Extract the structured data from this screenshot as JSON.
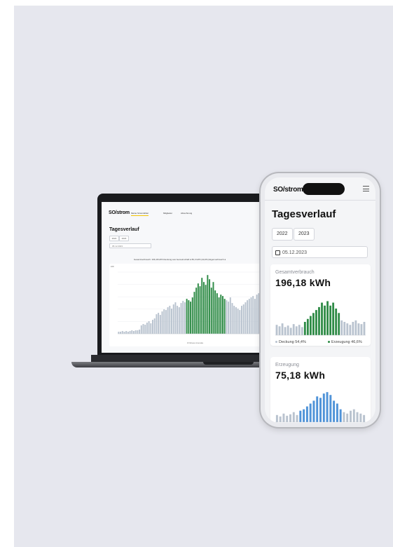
{
  "brand": "SO/strom",
  "desktop": {
    "nav": [
      "Meine Stromzähler",
      "Mitglieder",
      "Abrechnung"
    ],
    "title": "Tagesverlauf",
    "years": [
      "2022",
      "2023"
    ],
    "date": "05.12.2023",
    "stats": "Gesamtverbrauch: 196,18 kWh   Deckung aus Gemeinschaft ● 86,3 kWh (44,0%)   Eigenverbrauch ●",
    "y_axis_unit": "kWh",
    "x_axis_label": "15 Minuten Intervalle"
  },
  "mobile": {
    "title": "Tagesverlauf",
    "years": [
      "2022",
      "2023"
    ],
    "date": "05.12.2023",
    "consumption_card": {
      "label": "Gesamtverbrauch",
      "value": "196,18 kWh",
      "legend_left": "Deckung 54,4%",
      "legend_right": "Erzeugung 46,6%"
    },
    "production_card": {
      "label": "Erzeugung",
      "value": "75,18 kWh"
    }
  },
  "colors": {
    "grey_bar": "#b9c3cf",
    "green_bar": "#2e8b46",
    "blue_bar": "#4f93d8",
    "accent": "#f2c400",
    "background": "#e6e7ee"
  },
  "chart_data": [
    {
      "type": "bar",
      "title": "",
      "ylabel": "kWh",
      "xlabel": "15 Minuten Intervalle",
      "series": [
        {
          "values": [
            3,
            3,
            4,
            3,
            4,
            3,
            4,
            5,
            4,
            5,
            5,
            6,
            12,
            14,
            13,
            16,
            18,
            15,
            20,
            22,
            28,
            30,
            27,
            32,
            35,
            34,
            38,
            40,
            36,
            42,
            45,
            40,
            38,
            44,
            47,
            45,
            50,
            48,
            46,
            52,
            50,
            55,
            58,
            56,
            60,
            62,
            58,
            64,
            60,
            55,
            66,
            62,
            58,
            52,
            56,
            54,
            50,
            48,
            46,
            52,
            44,
            40,
            38,
            36,
            34,
            40,
            42,
            45,
            48,
            50,
            52,
            54,
            50,
            56,
            58,
            60,
            56,
            52,
            50,
            48,
            46,
            44,
            42,
            40
          ]
        },
        {
          "values": [
            0,
            0,
            0,
            0,
            0,
            0,
            0,
            0,
            0,
            0,
            0,
            0,
            0,
            0,
            0,
            0,
            0,
            0,
            0,
            0,
            0,
            0,
            0,
            0,
            0,
            0,
            0,
            0,
            0,
            0,
            0,
            0,
            0,
            0,
            0,
            0,
            30,
            42,
            38,
            52,
            60,
            66,
            72,
            68,
            80,
            74,
            70,
            84,
            78,
            66,
            74,
            62,
            54,
            48,
            42,
            30,
            22,
            0,
            0,
            0,
            0,
            0,
            0,
            0,
            0,
            0,
            0,
            0,
            0,
            0,
            0,
            0,
            0,
            0,
            0,
            0,
            0,
            0,
            0,
            0,
            0,
            0,
            0,
            0
          ]
        }
      ]
    },
    {
      "type": "bar",
      "title": "",
      "series": [
        {
          "values": [
            14,
            12,
            16,
            11,
            13,
            10,
            15,
            12,
            14,
            11,
            18,
            22,
            26,
            30,
            34,
            36,
            44,
            40,
            46,
            38,
            44,
            36,
            30,
            20,
            18,
            16,
            14,
            18,
            20,
            16,
            15,
            18
          ]
        },
        {
          "values": [
            0,
            0,
            0,
            0,
            0,
            0,
            0,
            0,
            0,
            0,
            16,
            20,
            24,
            30,
            34,
            38,
            44,
            38,
            46,
            40,
            42,
            30,
            26,
            0,
            0,
            0,
            0,
            0,
            0,
            0,
            0,
            0
          ]
        }
      ]
    },
    {
      "type": "bar",
      "title": "",
      "series": [
        {
          "values": [
            10,
            8,
            12,
            9,
            11,
            14,
            10,
            16,
            18,
            22,
            26,
            30,
            36,
            34,
            40,
            42,
            38,
            30,
            26,
            18,
            14,
            12,
            16,
            18,
            14,
            12,
            10
          ]
        },
        {
          "values": [
            0,
            0,
            0,
            0,
            0,
            0,
            0,
            6,
            10,
            14,
            16,
            18,
            20,
            22,
            24,
            26,
            22,
            18,
            14,
            8,
            0,
            0,
            0,
            0,
            0,
            0,
            0
          ]
        }
      ]
    }
  ]
}
